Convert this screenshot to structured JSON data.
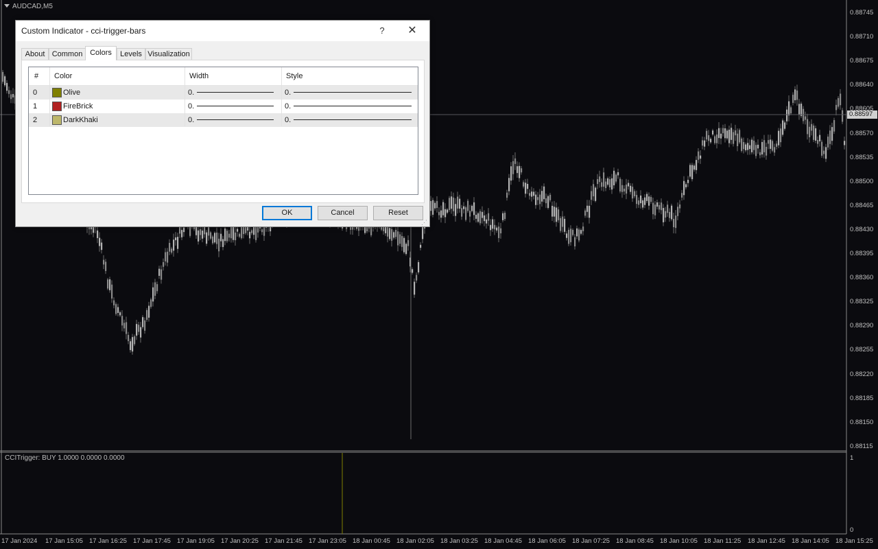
{
  "chart": {
    "symbol": "AUDCAD,M5",
    "indicator_label": "CCITrigger: BUY 1.0000 0.0000 0.0000",
    "current_price": "0.88597",
    "price_scale": [
      "0.88745",
      "0.88710",
      "0.88675",
      "0.88640",
      "0.88605",
      "0.88570",
      "0.88535",
      "0.88500",
      "0.88465",
      "0.88430",
      "0.88395",
      "0.88360",
      "0.88325",
      "0.88290",
      "0.88255",
      "0.88220",
      "0.88185",
      "0.88150",
      "0.88115"
    ],
    "indicator_scale": [
      "1",
      "0"
    ],
    "time_axis": [
      "17 Jan 2024",
      "17 Jan 15:05",
      "17 Jan 16:25",
      "17 Jan 17:45",
      "17 Jan 19:05",
      "17 Jan 20:25",
      "17 Jan 21:45",
      "17 Jan 23:05",
      "18 Jan 00:45",
      "18 Jan 02:05",
      "18 Jan 03:25",
      "18 Jan 04:45",
      "18 Jan 06:05",
      "18 Jan 07:25",
      "18 Jan 08:45",
      "18 Jan 10:05",
      "18 Jan 11:25",
      "18 Jan 12:45",
      "18 Jan 14:05",
      "18 Jan 15:25"
    ],
    "colors": {
      "background": "#0b0b0f",
      "candle": "#9a9a9a",
      "separator": "#7a7a7a",
      "signal": "#808000"
    }
  },
  "dialog": {
    "title": "Custom Indicator - cci-trigger-bars",
    "help": "?",
    "close": "✕",
    "tabs": [
      "About",
      "Common",
      "Colors",
      "Levels",
      "Visualization"
    ],
    "active_tab": "Colors",
    "table": {
      "columns": [
        "#",
        "Color",
        "Width",
        "Style"
      ],
      "rows": [
        {
          "index": "0",
          "color": "Olive",
          "hex": "#808000",
          "width": "0.",
          "style": "0."
        },
        {
          "index": "1",
          "color": "FireBrick",
          "hex": "#b22222",
          "width": "0.",
          "style": "0."
        },
        {
          "index": "2",
          "color": "DarkKhaki",
          "hex": "#bdb76b",
          "width": "0.",
          "style": "0."
        }
      ]
    },
    "buttons": {
      "ok": "OK",
      "cancel": "Cancel",
      "reset": "Reset"
    }
  }
}
